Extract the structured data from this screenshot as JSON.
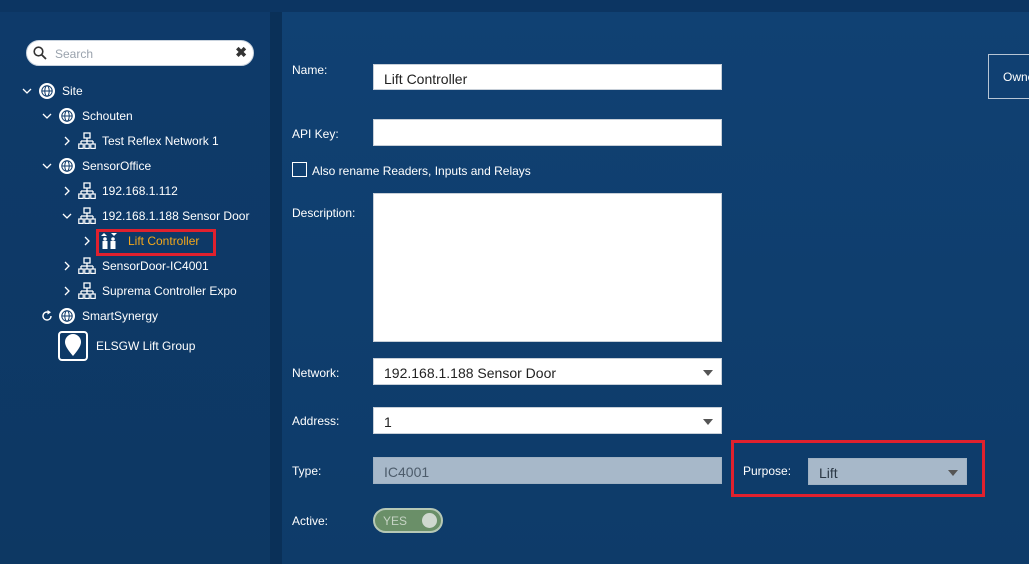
{
  "search": {
    "placeholder": "Search",
    "clear_glyph": "✖"
  },
  "tree": [
    {
      "label": "Site",
      "icon": "globe-icon",
      "chevron": "down"
    },
    {
      "label": "Schouten",
      "icon": "globe-icon",
      "chevron": "down"
    },
    {
      "label": "Test Reflex Network 1",
      "icon": "network-icon",
      "chevron": "right"
    },
    {
      "label": "SensorOffice",
      "icon": "globe-icon",
      "chevron": "down"
    },
    {
      "label": "192.168.1.112",
      "icon": "network-icon",
      "chevron": "right"
    },
    {
      "label": "192.168.1.188 Sensor Door",
      "icon": "network-icon",
      "chevron": "down"
    },
    {
      "label": "Lift Controller",
      "icon": "lift-icon",
      "chevron": "right"
    },
    {
      "label": "SensorDoor-IC4001",
      "icon": "network-icon",
      "chevron": "right"
    },
    {
      "label": "Suprema Controller Expo",
      "icon": "network-icon",
      "chevron": "right"
    },
    {
      "label": "SmartSynergy",
      "icon": "globe-icon",
      "chevron": "refresh"
    },
    {
      "label": "ELSGW Lift Group",
      "icon": "lift-group-icon",
      "chevron": "none"
    }
  ],
  "form": {
    "name_label": "Name:",
    "name_value": "Lift Controller",
    "api_key_label": "API Key:",
    "api_key_value": "",
    "rename_checkbox_label": "Also rename Readers, Inputs and Relays",
    "description_label": "Description:",
    "description_value": "",
    "network_label": "Network:",
    "network_value": "192.168.1.188 Sensor Door",
    "address_label": "Address:",
    "address_value": "1",
    "type_label": "Type:",
    "type_value": "IC4001",
    "purpose_label": "Purpose:",
    "purpose_value": "Lift",
    "active_label": "Active:",
    "active_value": "YES"
  },
  "owner_button_label": "Owne",
  "colors": {
    "highlight": "#e0212e",
    "selected_text": "#f3a71b",
    "background": "#0f3b6b"
  }
}
